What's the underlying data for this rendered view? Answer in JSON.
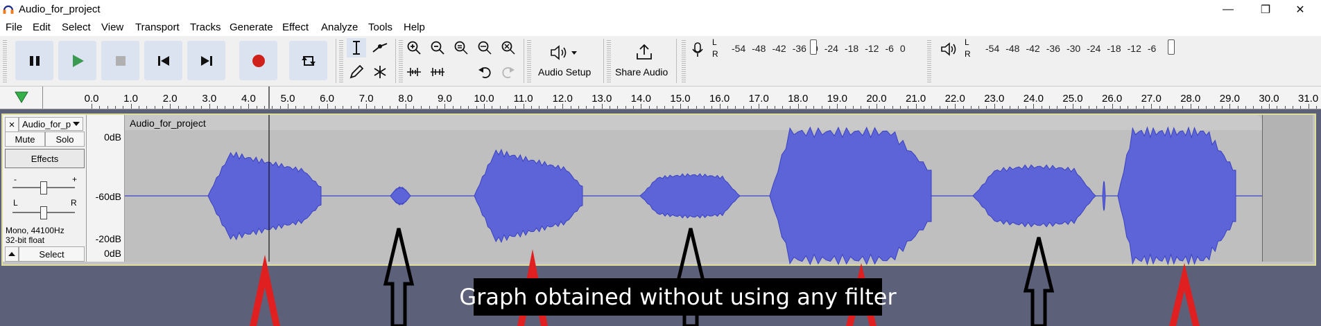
{
  "window": {
    "title": "Audio_for_project",
    "minimize_glyph": "—",
    "restore_glyph": "❐",
    "close_glyph": "✕"
  },
  "menu": [
    "File",
    "Edit",
    "Select",
    "View",
    "Transport",
    "Tracks",
    "Generate",
    "Effect",
    "Analyze",
    "Tools",
    "Help"
  ],
  "toolbar": {
    "transport": [
      "pause-icon",
      "play-icon",
      "stop-icon",
      "skip-to-start-icon",
      "skip-to-end-icon",
      "record-icon",
      "loop-icon"
    ],
    "audio_setup_label": "Audio Setup",
    "share_audio_label": "Share Audio",
    "record_meter_ticks": [
      "-54",
      "-48",
      "-42",
      "-36",
      "0",
      "-24",
      "-18",
      "-12",
      "-6",
      "0"
    ],
    "playback_meter_ticks": [
      "-54",
      "-48",
      "-42",
      "-36",
      "-30",
      "-24",
      "-18",
      "-12",
      "-6"
    ],
    "meter_L": "L",
    "meter_R": "R"
  },
  "ruler": {
    "ticks": [
      "0.0",
      "1.0",
      "2.0",
      "3.0",
      "4.0",
      "5.0",
      "6.0",
      "7.0",
      "8.0",
      "9.0",
      "10.0",
      "11.0",
      "12.0",
      "13.0",
      "14.0",
      "15.0",
      "16.0",
      "17.0",
      "18.0",
      "19.0",
      "20.0",
      "21.0",
      "22.0",
      "23.0",
      "24.0",
      "25.0",
      "26.0",
      "27.0",
      "28.0",
      "29.0",
      "30.0",
      "31.0"
    ]
  },
  "track": {
    "name": "Audio_for_p",
    "close_glyph": "×",
    "mute_label": "Mute",
    "solo_label": "Solo",
    "effects_label": "Effects",
    "gain_minus": "-",
    "gain_plus": "+",
    "pan_L": "L",
    "pan_R": "R",
    "format_line1": "Mono, 44100Hz",
    "format_line2": "32-bit float",
    "select_label": "Select",
    "scale": [
      "0dB",
      "-60dB",
      "-20dB",
      "0dB"
    ],
    "clip_name": "Audio_for_project",
    "waveform_color": "#5d64d8"
  },
  "caption": "Graph obtained without using any filter"
}
